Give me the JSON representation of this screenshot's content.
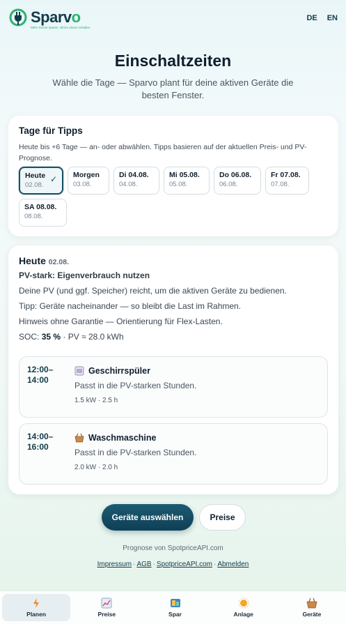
{
  "brand": {
    "name_main": "Sparv",
    "name_accent": "o",
    "tagline": "Mehr Sonne sparen. Strom clever schalten."
  },
  "lang": [
    "DE",
    "EN"
  ],
  "header": {
    "title": "Einschaltzeiten",
    "subtitle": "Wähle die Tage — Sparvo plant für deine aktiven Geräte die besten Fenster."
  },
  "days_card": {
    "title": "Tage für Tipps",
    "hint": "Heute bis +6 Tage — an- oder abwählen. Tipps basieren auf der aktuellen Preis- und PV-Prognose.",
    "chips": [
      {
        "day": "Heute",
        "date": "02.08.",
        "selected": true
      },
      {
        "day": "Morgen",
        "date": "03.08."
      },
      {
        "day": "Di 04.08.",
        "date": "04.08."
      },
      {
        "day": "Mi 05.08.",
        "date": "05.08."
      },
      {
        "day": "Do 06.08.",
        "date": "06.08."
      },
      {
        "day": "Fr 07.08.",
        "date": "07.08."
      },
      {
        "day": "SA 08.08.",
        "date": "08.08."
      }
    ],
    "check": "✓"
  },
  "plan": {
    "day": "Heute",
    "date": "02.08.",
    "mode": "PV-stark: Eigenverbrauch nutzen",
    "line1": "Deine PV (und ggf. Speicher) reicht, um die aktiven Geräte zu bedienen.",
    "line2": "Tipp: Geräte nacheinander — so bleibt die Last im Rahmen.",
    "line3": "Hinweis ohne Garantie — Orientierung für Flex-Lasten.",
    "soc_label": "SOC:",
    "soc_value": "35 %",
    "pv_text": "· PV ≈ 28.0 kWh",
    "slots": [
      {
        "time_start": "12:00–",
        "time_end": "14:00",
        "device": "Geschirrspüler",
        "icon": "dishwasher-icon",
        "reason": "Passt in die PV-starken Stunden.",
        "meta": "1.5 kW · 2.5 h"
      },
      {
        "time_start": "14:00–",
        "time_end": "16:00",
        "device": "Waschmaschine",
        "icon": "washing-machine-icon",
        "reason": "Passt in die PV-starken Stunden.",
        "meta": "2.0 kW · 2.0 h"
      }
    ]
  },
  "actions": {
    "primary": "Geräte auswählen",
    "secondary": "Preise"
  },
  "footer": {
    "source": "Prognose von SpotpriceAPI.com",
    "links": [
      "Impressum",
      "AGB",
      "SpotpriceAPI.com",
      "Abmelden"
    ],
    "sep": "·"
  },
  "nav": [
    {
      "label": "Planen",
      "icon": "lightning-icon",
      "active": true
    },
    {
      "label": "Preise",
      "icon": "chart-icon"
    },
    {
      "label": "Spar",
      "icon": "piggy-icon"
    },
    {
      "label": "Anlage",
      "icon": "sun-icon"
    },
    {
      "label": "Geräte",
      "icon": "basket-icon"
    }
  ],
  "colors": {
    "brand_dark": "#123b4a",
    "brand_green": "#28b36b",
    "primary_btn": "#0f3f55"
  }
}
